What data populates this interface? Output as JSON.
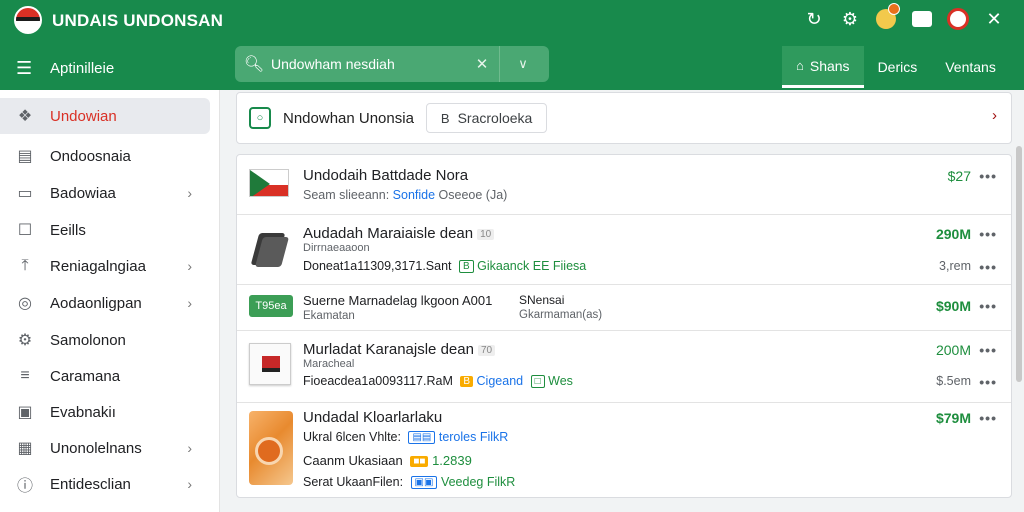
{
  "app": {
    "title": "UNDAIS UNDONSAN",
    "menu_label": "Aptinilleie"
  },
  "search": {
    "placeholder": "Undowham nesdiah"
  },
  "header_tabs": [
    {
      "label": "Shans",
      "active": true,
      "icon": "home-icon"
    },
    {
      "label": "Derics",
      "active": false
    },
    {
      "label": "Ventans",
      "active": false
    }
  ],
  "header_icons": [
    "refresh-icon",
    "settings-icon",
    "notifications-icon",
    "mail-icon",
    "avatar",
    "close-icon"
  ],
  "sidebar": {
    "items": [
      {
        "label": "Undowian",
        "icon": "tag-icon",
        "active": true,
        "chevron": false
      },
      {
        "label": "Ondoosnaia",
        "icon": "document-icon",
        "active": false,
        "chevron": false
      },
      {
        "label": "Badowiaa",
        "icon": "folder-icon",
        "active": false,
        "chevron": true
      },
      {
        "label": "Eeills",
        "icon": "edit-icon",
        "active": false,
        "chevron": false
      },
      {
        "label": "Reniagalngiaa",
        "icon": "upload-icon",
        "active": false,
        "chevron": true
      },
      {
        "label": "Aodaonligpan",
        "icon": "globe-icon",
        "active": false,
        "chevron": true
      },
      {
        "label": "Samolonon",
        "icon": "gear-icon",
        "active": false,
        "chevron": false
      },
      {
        "label": "Caramana",
        "icon": "list-icon",
        "active": false,
        "chevron": false
      },
      {
        "label": "Evabnakiı",
        "icon": "terminal-icon",
        "active": false,
        "chevron": false
      },
      {
        "label": "Unonolelnans",
        "icon": "calendar-icon",
        "active": false,
        "chevron": true
      },
      {
        "label": "Entidesclian",
        "icon": "info-icon",
        "active": false,
        "chevron": true
      }
    ]
  },
  "breadcrumb": {
    "title": "Nndowhan Unonsia",
    "chip_label": "Sracroloeka"
  },
  "rows": [
    {
      "title": "Undodaih Battdade Nora",
      "sub_a": "Seam slieeann:",
      "sub_b": "Sonfide",
      "sub_c": "Oseeoe (Ja)",
      "price": "$27"
    },
    {
      "title": "Audadah Maraiaisle dean",
      "tag": "10",
      "sub_1": "Dirrnaeaaoon",
      "sub_2": "Doneat1a11309,3171.Sant",
      "tag_b": "B",
      "status": "Gikaanck EE Fiiesa",
      "price": "290M",
      "meta": "3,rem"
    },
    {
      "badge": "T95ea",
      "title": "Suerne Marnadelag lkgoon",
      "code": "A001",
      "col2_a": "SNensai",
      "col2_b": "Gkarmaman(as)",
      "sub_1": "Ekamatan",
      "price": "$90M"
    },
    {
      "title": "Murladat Karanajsle dean",
      "tag": "70",
      "sub_1": "Maracheal",
      "sub_2": "Fioeacdea1a0093117.RaM",
      "tag_b": "B",
      "status": "Cigeand",
      "status_2": "Wes",
      "price": "200M",
      "meta": "$.5em"
    },
    {
      "title": "Undadal Kloarlarlaku",
      "sub_1": "Ukral 6lcen Vhlte:",
      "sub_1b": "teroles FilkR",
      "sub_2": "Caanm Ukasiaan",
      "sub_2b": "1.2839",
      "sub_3": "Serat UkaanFilen:",
      "sub_3b": "Veedeg FilkR",
      "price": "$79M"
    }
  ],
  "more_label": "•••",
  "colors": {
    "header": "#188a4c",
    "accent_red": "#d93025",
    "price_green": "#1e8e3e"
  }
}
